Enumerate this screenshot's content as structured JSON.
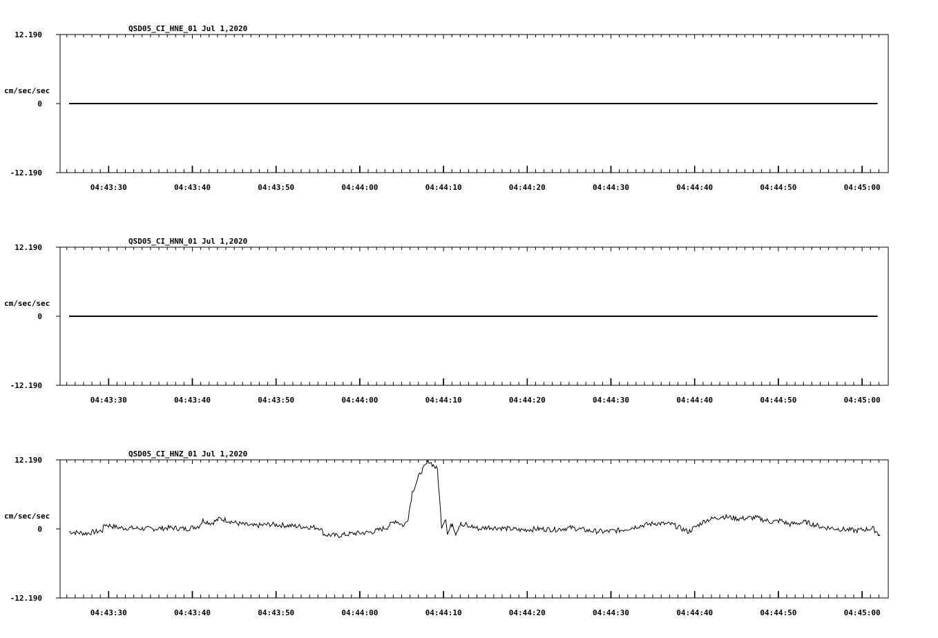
{
  "chart_data": [
    {
      "type": "line",
      "title": "QSD05_CI_HNE_01  Jul 1,2020",
      "ylabel": "cm/sec/sec",
      "ylim": [
        -12.19,
        12.19
      ],
      "ytick_labels": [
        "12.190",
        "0",
        "-12.190"
      ],
      "x_start": "04:43:25",
      "x_end": "04:45:04",
      "xtick_labels": [
        "04:43:30",
        "04:43:40",
        "04:43:50",
        "04:44:00",
        "04:44:10",
        "04:44:20",
        "04:44:30",
        "04:44:40",
        "04:44:50",
        "04:45:00"
      ],
      "series": [
        {
          "x": [
            0,
            97
          ],
          "values": [
            0,
            0
          ]
        }
      ]
    },
    {
      "type": "line",
      "title": "QSD05_CI_HNN_01  Jul 1,2020",
      "ylabel": "cm/sec/sec",
      "ylim": [
        -12.19,
        12.19
      ],
      "ytick_labels": [
        "12.190",
        "0",
        "-12.190"
      ],
      "x_start": "04:43:25",
      "x_end": "04:45:04",
      "xtick_labels": [
        "04:43:30",
        "04:43:40",
        "04:43:50",
        "04:44:00",
        "04:44:10",
        "04:44:20",
        "04:44:30",
        "04:44:40",
        "04:44:50",
        "04:45:00"
      ],
      "series": [
        {
          "x": [
            0,
            97
          ],
          "values": [
            0,
            0
          ]
        }
      ]
    },
    {
      "type": "line",
      "title": "QSD05_CI_HNZ_01  Jul 1,2020",
      "ylabel": "cm/sec/sec",
      "ylim": [
        -12.19,
        12.19
      ],
      "ytick_labels": [
        "12.190",
        "0",
        "-12.190"
      ],
      "x_start": "04:43:25",
      "x_end": "04:45:04",
      "xtick_labels": [
        "04:43:30",
        "04:43:40",
        "04:43:50",
        "04:44:00",
        "04:44:10",
        "04:44:20",
        "04:44:30",
        "04:44:40",
        "04:44:50",
        "04:45:00"
      ],
      "series": [
        {
          "x": [
            0,
            2,
            4,
            4.2,
            6,
            8,
            10,
            12,
            14,
            15.5,
            16,
            17,
            18,
            19,
            20,
            22,
            24,
            26,
            28,
            30,
            30.5,
            32,
            34,
            36,
            37,
            38,
            39,
            40,
            40.5,
            41,
            42,
            43,
            44,
            44.5,
            45,
            45.2,
            45.6,
            45.8,
            46.2,
            46.6,
            46.8,
            47,
            47.4,
            47.8,
            48,
            49,
            50,
            52,
            54,
            56,
            58,
            60,
            62,
            64,
            66,
            68,
            70,
            72,
            74,
            76,
            78,
            80,
            82,
            84,
            85,
            86,
            88,
            90,
            92,
            94,
            96,
            97
          ],
          "values": [
            -0.5,
            -0.8,
            -0.3,
            0.8,
            0.2,
            0.1,
            0.0,
            0.2,
            0.0,
            0.5,
            1.5,
            1.0,
            1.8,
            1.5,
            1.0,
            0.5,
            0.8,
            0.6,
            0.4,
            0.2,
            -1.0,
            -1.2,
            -0.8,
            -0.6,
            -0.2,
            0.3,
            1.5,
            0.5,
            2.0,
            6.5,
            10.0,
            12.0,
            10.5,
            0.5,
            2.0,
            -1.0,
            0.5,
            1.0,
            -0.8,
            0.6,
            1.2,
            0.3,
            0.8,
            0.2,
            0.5,
            0.0,
            0.3,
            0.1,
            -0.2,
            0.0,
            -0.1,
            0.2,
            -0.3,
            -0.5,
            -0.2,
            0.5,
            1.0,
            0.8,
            -0.5,
            1.5,
            2.2,
            1.8,
            2.0,
            1.2,
            1.5,
            0.8,
            1.2,
            0.3,
            0.0,
            -0.3,
            0.1,
            -1.2
          ]
        }
      ]
    }
  ]
}
